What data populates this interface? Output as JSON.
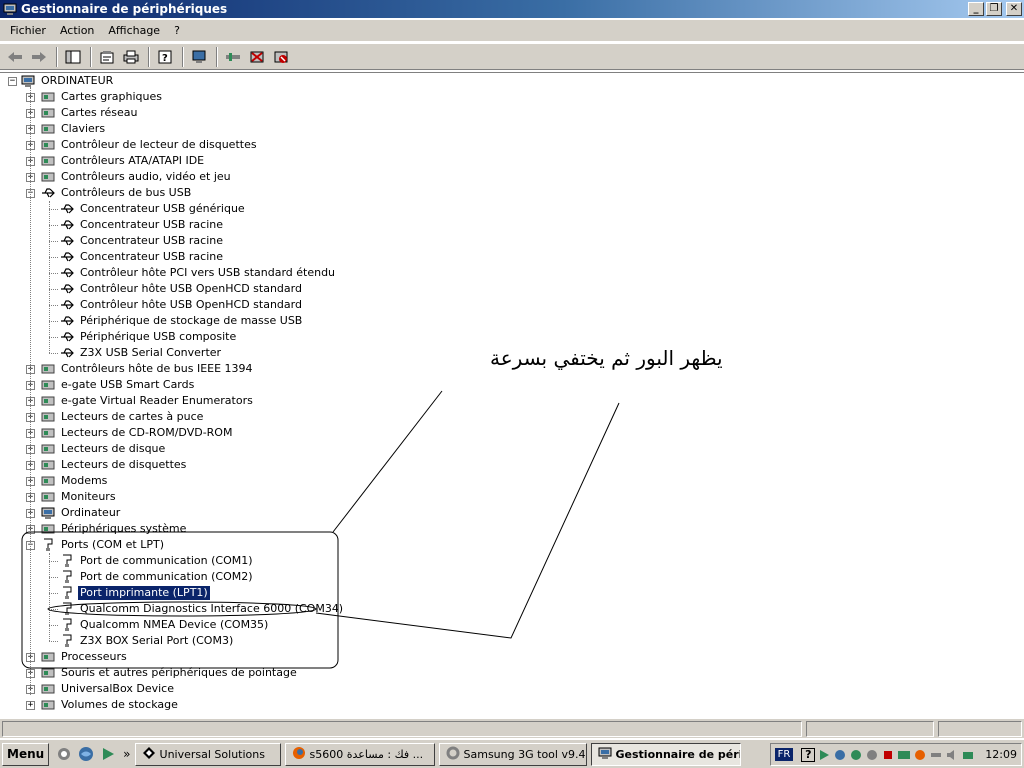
{
  "window": {
    "title": "Gestionnaire de périphériques",
    "minimize_glyph": "_",
    "maximize_glyph": "❐",
    "close_glyph": "✕"
  },
  "menu": [
    "Fichier",
    "Action",
    "Affichage",
    "?"
  ],
  "toolbar": {
    "icons": [
      "back-arrow-icon",
      "forward-arrow-icon",
      "console-tree-icon",
      "properties-icon",
      "print-icon",
      "help-icon",
      "computer-scan-icon",
      "update-driver-icon",
      "uninstall-icon",
      "disable-icon"
    ]
  },
  "tree": [
    {
      "label": "ORDINATEUR",
      "level": 0,
      "expander": "−",
      "icon": "computer-icon"
    },
    {
      "label": "Cartes graphiques",
      "level": 1,
      "expander": "+",
      "icon": "display-adapter-icon"
    },
    {
      "label": "Cartes réseau",
      "level": 1,
      "expander": "+",
      "icon": "network-card-icon"
    },
    {
      "label": "Claviers",
      "level": 1,
      "expander": "+",
      "icon": "keyboard-icon"
    },
    {
      "label": "Contrôleur de lecteur de disquettes",
      "level": 1,
      "expander": "+",
      "icon": "floppy-controller-icon"
    },
    {
      "label": "Contrôleurs ATA/ATAPI IDE",
      "level": 1,
      "expander": "+",
      "icon": "ide-controller-icon"
    },
    {
      "label": "Contrôleurs audio, vidéo et jeu",
      "level": 1,
      "expander": "+",
      "icon": "audio-icon"
    },
    {
      "label": "Contrôleurs de bus USB",
      "level": 1,
      "expander": "−",
      "icon": "usb-icon"
    },
    {
      "label": "Concentrateur USB générique",
      "level": 2,
      "icon": "usb-icon"
    },
    {
      "label": "Concentrateur USB racine",
      "level": 2,
      "icon": "usb-icon"
    },
    {
      "label": "Concentrateur USB racine",
      "level": 2,
      "icon": "usb-icon"
    },
    {
      "label": "Concentrateur USB racine",
      "level": 2,
      "icon": "usb-icon"
    },
    {
      "label": "Contrôleur hôte PCI vers USB standard étendu",
      "level": 2,
      "icon": "usb-icon"
    },
    {
      "label": "Contrôleur hôte USB OpenHCD standard",
      "level": 2,
      "icon": "usb-icon"
    },
    {
      "label": "Contrôleur hôte USB OpenHCD standard",
      "level": 2,
      "icon": "usb-icon"
    },
    {
      "label": "Périphérique de stockage de masse USB",
      "level": 2,
      "icon": "usb-icon"
    },
    {
      "label": "Périphérique USB composite",
      "level": 2,
      "icon": "usb-icon"
    },
    {
      "label": "Z3X USB Serial Converter",
      "level": 2,
      "icon": "usb-icon"
    },
    {
      "label": "Contrôleurs hôte de bus IEEE 1394",
      "level": 1,
      "expander": "+",
      "icon": "ieee1394-icon"
    },
    {
      "label": "e-gate USB Smart Cards",
      "level": 1,
      "expander": "+",
      "icon": "smartcard-icon"
    },
    {
      "label": "e-gate Virtual Reader Enumerators",
      "level": 1,
      "expander": "+",
      "icon": "reader-icon"
    },
    {
      "label": "Lecteurs de cartes à puce",
      "level": 1,
      "expander": "+",
      "icon": "smartcard-reader-icon"
    },
    {
      "label": "Lecteurs de CD-ROM/DVD-ROM",
      "level": 1,
      "expander": "+",
      "icon": "cdrom-icon"
    },
    {
      "label": "Lecteurs de disque",
      "level": 1,
      "expander": "+",
      "icon": "disk-drive-icon"
    },
    {
      "label": "Lecteurs de disquettes",
      "level": 1,
      "expander": "+",
      "icon": "floppy-icon"
    },
    {
      "label": "Modems",
      "level": 1,
      "expander": "+",
      "icon": "modem-icon"
    },
    {
      "label": "Moniteurs",
      "level": 1,
      "expander": "+",
      "icon": "monitor-icon"
    },
    {
      "label": "Ordinateur",
      "level": 1,
      "expander": "+",
      "icon": "computer-icon"
    },
    {
      "label": "Périphériques système",
      "level": 1,
      "expander": "+",
      "icon": "system-device-icon"
    },
    {
      "label": "Ports (COM et LPT)",
      "level": 1,
      "expander": "−",
      "icon": "port-icon"
    },
    {
      "label": "Port de communication (COM1)",
      "level": 2,
      "icon": "port-icon"
    },
    {
      "label": "Port de communication (COM2)",
      "level": 2,
      "icon": "port-icon"
    },
    {
      "label": "Port imprimante (LPT1)",
      "level": 2,
      "icon": "port-icon",
      "selected": true
    },
    {
      "label": "Qualcomm Diagnostics Interface 6000 (COM34)",
      "level": 2,
      "icon": "port-icon"
    },
    {
      "label": "Qualcomm NMEA Device (COM35)",
      "level": 2,
      "icon": "port-icon"
    },
    {
      "label": "Z3X BOX Serial Port (COM3)",
      "level": 2,
      "icon": "port-icon"
    },
    {
      "label": "Processeurs",
      "level": 1,
      "expander": "+",
      "icon": "processor-icon"
    },
    {
      "label": "Souris et autres périphériques de pointage",
      "level": 1,
      "expander": "+",
      "icon": "mouse-icon"
    },
    {
      "label": "UniversalBox Device",
      "level": 1,
      "expander": "+",
      "icon": "network-card-icon"
    },
    {
      "label": "Volumes de stockage",
      "level": 1,
      "expander": "+",
      "icon": "storage-volume-icon"
    }
  ],
  "annotation": {
    "text": "يظهر البور ثم يختفي بسرعة"
  },
  "taskbar": {
    "start_label": "Menu",
    "more_glyph": "»",
    "tasks": [
      {
        "label": "Universal Solutions",
        "icon": "universal-solutions-icon"
      },
      {
        "label": "s5600 فك : مساعدة ...",
        "icon": "firefox-icon"
      },
      {
        "label": "Samsung 3G tool v9.4",
        "icon": "samsung-tool-icon"
      },
      {
        "label": "Gestionnaire de péri...",
        "icon": "device-manager-icon",
        "active": true
      }
    ],
    "language": "FR",
    "help_glyph": "?",
    "clock": "12:09"
  }
}
